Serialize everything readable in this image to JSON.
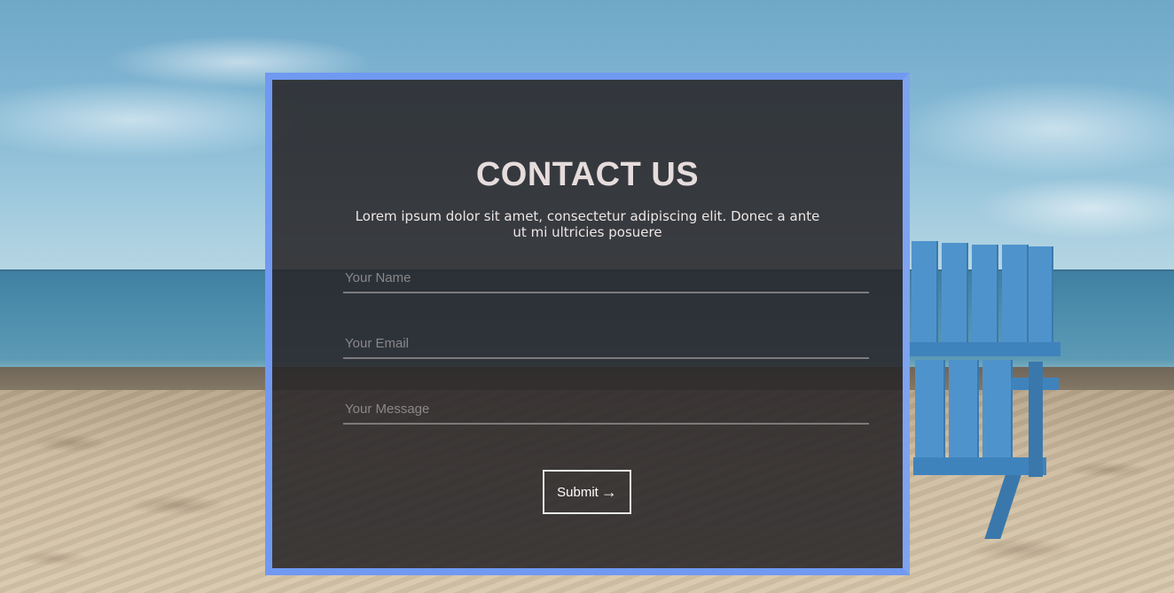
{
  "contact": {
    "title": "CONTACT US",
    "description": "Lorem ipsum dolor sit amet, consectetur adipiscing elit. Donec a ante ut mi ultricies posuere",
    "fields": {
      "name": {
        "placeholder": "Your Name",
        "value": ""
      },
      "email": {
        "placeholder": "Your Email",
        "value": ""
      },
      "message": {
        "placeholder": "Your Message",
        "value": ""
      }
    },
    "submit": {
      "label": "Submit",
      "icon": "arrow-right-icon",
      "glyph": "→"
    }
  },
  "colors": {
    "frame": "#7099f1",
    "card_overlay": "#282628",
    "title": "#e6dcdc",
    "placeholder": "#8a878a",
    "underline": "#7d7a7d"
  }
}
